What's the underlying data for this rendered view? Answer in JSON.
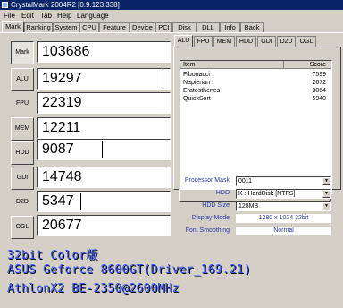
{
  "window": {
    "title": "CrystalMark 2004R2 [0.9.123.338]"
  },
  "menu": [
    "File",
    "Edit",
    "Tab",
    "Help",
    "Language"
  ],
  "main_tabs": [
    "Mark",
    "Ranking",
    "System",
    "CPU",
    "Feature",
    "Device",
    "PCI",
    "Disk",
    "DLL",
    "Info",
    "Back"
  ],
  "side": {
    "mark_button": "Mark",
    "alu_button": "ALU",
    "fpu_label": "FPU",
    "mem_button": "MEM",
    "hdd_button": "HDD",
    "gdi_button": "GDI",
    "d2d_label": "D2D",
    "ogl_button": "OGL"
  },
  "scores": {
    "mark": "103686",
    "alu": "19297",
    "fpu": "22319",
    "mem": "12211",
    "hdd": "9087",
    "gdi": "14748",
    "d2d": "5347",
    "ogl": "20677"
  },
  "sub_tabs": [
    "ALU",
    "FPU",
    "MEM",
    "HDD",
    "GDI",
    "D2D",
    "OGL"
  ],
  "results": {
    "header": {
      "item": "Item",
      "score": "Score"
    },
    "rows": [
      {
        "item": "Fibonacci",
        "score": "7599"
      },
      {
        "item": "Napierian",
        "score": "2672"
      },
      {
        "item": "Eratosthenes",
        "score": "3064"
      },
      {
        "item": "QuickSort",
        "score": "5940"
      }
    ]
  },
  "stop_button": "Stop",
  "options": {
    "processor_mask": {
      "label": "Processor Mask",
      "value": "0011"
    },
    "hdd": {
      "label": "HDD",
      "value": "K : HardDisk [NTFS]"
    },
    "hdd_size": {
      "label": "HDD Size",
      "value": "128MB"
    },
    "display_mode": {
      "label": "Display Mode",
      "value": "1280 x 1024 32bit"
    },
    "font_smoothing": {
      "label": "Font Smoothing",
      "value": "Normal"
    }
  },
  "overlay": {
    "line1": "32bit Color版",
    "line2": "ASUS Geforce 8600GT(Driver_169.21)",
    "line3": "AthlonX2 BE-2350@2600MHz"
  },
  "colors": {
    "title_bar": "#0A246A",
    "overlay_text": "#3b5bff",
    "option_label": "#2a3ba8"
  }
}
